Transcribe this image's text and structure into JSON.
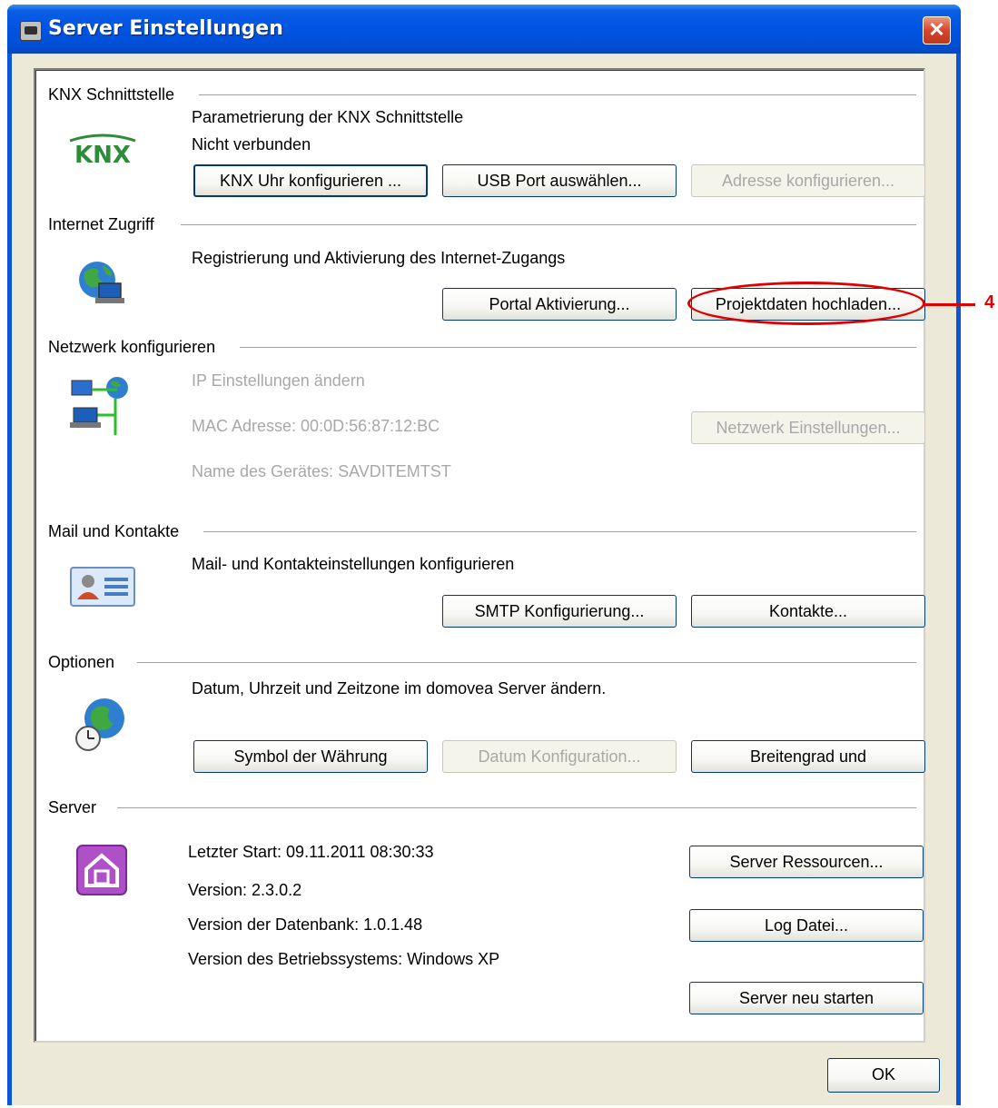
{
  "window": {
    "title": "Server Einstellungen",
    "close_label": "✕",
    "ok_label": "OK"
  },
  "sections": {
    "knx": {
      "title": "KNX Schnittstelle",
      "logo_text": "KNX",
      "line1": "Parametrierung der KNX Schnittstelle",
      "line2": "Nicht verbunden",
      "btn_uhr": "KNX Uhr konfigurieren ...",
      "btn_usb": "USB Port auswählen...",
      "btn_adresse": "Adresse konfigurieren..."
    },
    "internet": {
      "title": "Internet Zugriff",
      "line1": "Registrierung und Aktivierung des Internet-Zugangs",
      "btn_portal": "Portal Aktivierung...",
      "btn_projekt": "Projektdaten hochladen..."
    },
    "netzwerk": {
      "title": "Netzwerk konfigurieren",
      "line1": "IP Einstellungen ändern",
      "mac": "MAC Adresse: 00:0D:56:87:12:BC",
      "name": "Name des Gerätes: SAVDITEMTST",
      "btn_settings": "Netzwerk Einstellungen..."
    },
    "mail": {
      "title": "Mail und Kontakte",
      "line1": "Mail- und Kontakteinstellungen konfigurieren",
      "btn_smtp": "SMTP Konfigurierung...",
      "btn_kontakte": "Kontakte..."
    },
    "optionen": {
      "title": "Optionen",
      "line1": "Datum, Uhrzeit und Zeitzone im domovea Server ändern.",
      "btn_symbol": "Symbol der Währung",
      "btn_datum": "Datum Konfiguration...",
      "btn_breiten": "Breitengrad und"
    },
    "server": {
      "title": "Server",
      "start": "Letzter Start: 09.11.2011 08:30:33",
      "version": "Version: 2.3.0.2",
      "db_version": "Version der Datenbank: 1.0.1.48",
      "os_version": "Version des Betriebssystems: Windows XP",
      "btn_ressourcen": "Server Ressourcen...",
      "btn_log": "Log Datei...",
      "btn_restart": "Server neu starten"
    }
  },
  "callout": {
    "number": "4"
  }
}
